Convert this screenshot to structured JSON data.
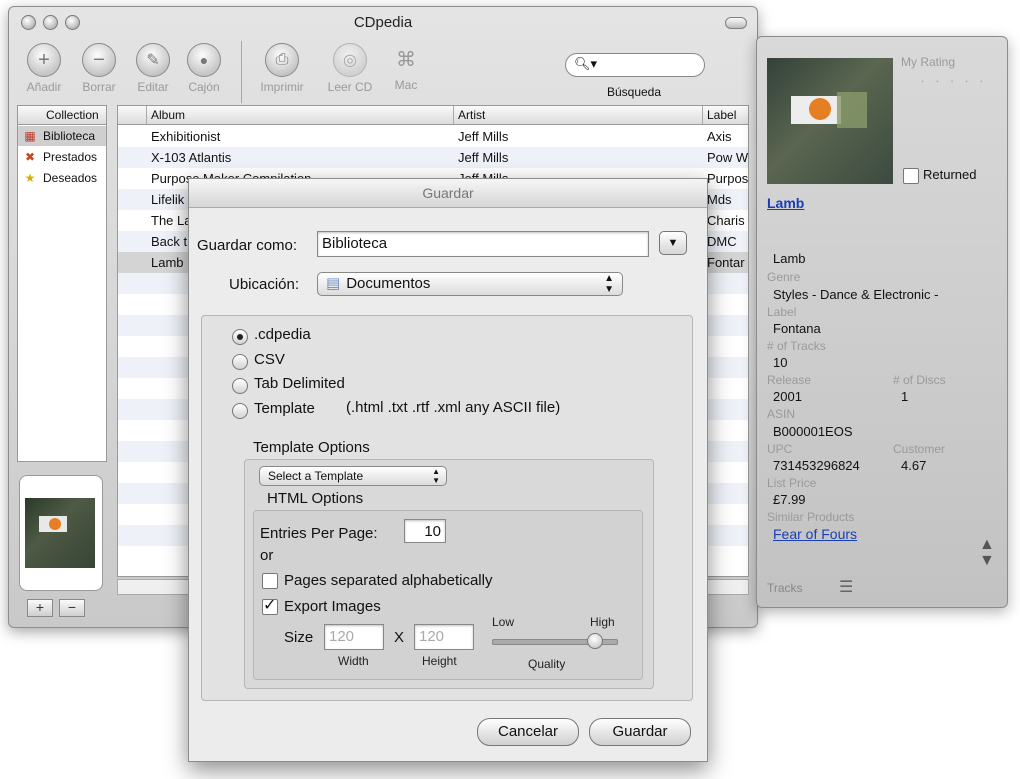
{
  "app": {
    "title": "CDpedia"
  },
  "toolbar": {
    "add": "Añadir",
    "delete": "Borrar",
    "edit": "Editar",
    "drawer": "Cajón",
    "print": "Imprimir",
    "read_cd": "Leer CD",
    "mac": "Mac",
    "search_label": "Búsqueda"
  },
  "sidebar": {
    "header": "Collection",
    "items": [
      {
        "label": "Biblioteca"
      },
      {
        "label": "Prestados"
      },
      {
        "label": "Deseados"
      }
    ]
  },
  "table": {
    "columns": [
      "Album",
      "Artist",
      "Label"
    ],
    "rows": [
      {
        "album": "Exhibitionist",
        "artist": "Jeff Mills",
        "label": "Axis"
      },
      {
        "album": "X-103 Atlantis",
        "artist": "Jeff Mills",
        "label": "Pow W"
      },
      {
        "album": "Purpose Maker Compilation",
        "artist": "Jeff Mills",
        "label": "Purpos"
      },
      {
        "album": "Lifelik",
        "artist": "",
        "label": "Mds"
      },
      {
        "album": "The La",
        "artist": "",
        "label": "Charis"
      },
      {
        "album": "Back t",
        "artist": "",
        "label": "DMC"
      },
      {
        "album": "Lamb",
        "artist": "",
        "label": "Fontar"
      }
    ]
  },
  "details": {
    "my_rating_label": "My Rating",
    "rating_dots": ". . . . .",
    "returned_label": "Returned",
    "title_link": "Lamb",
    "artist": "Lamb",
    "genre_label": "Genre",
    "genre": "Styles - Dance & Electronic -",
    "label_label": "Label",
    "label": "Fontana",
    "tracks_count_label": "# of Tracks",
    "tracks_count": "10",
    "release_label": "Release",
    "release": "2001",
    "discs_label": "# of Discs",
    "discs": "1",
    "asin_label": "ASIN",
    "asin": "B000001EOS",
    "upc_label": "UPC",
    "upc": "731453296824",
    "customer_label": "Customer",
    "customer": "4.67",
    "list_price_label": "List Price",
    "list_price": "£7.99",
    "similar_label": "Similar Products",
    "similar_link": "Fear of Fours",
    "tracks_label": "Tracks"
  },
  "dialog": {
    "title": "Guardar",
    "save_as_label": "Guardar como:",
    "save_as_value": "Biblioteca",
    "location_label": "Ubicación:",
    "location_value": "Documentos",
    "formats": [
      {
        "label": ".cdpedia",
        "selected": true
      },
      {
        "label": "CSV",
        "selected": false
      },
      {
        "label": "Tab Delimited",
        "selected": false
      },
      {
        "label": "Template",
        "selected": false
      }
    ],
    "template_extensions": "(.html .txt .rtf .xml any ASCII file)",
    "template_options_label": "Template Options",
    "select_template": "Select a Template",
    "html_options_label": "HTML Options",
    "entries_per_page_label": "Entries Per Page:",
    "entries_per_page": "10",
    "or_label": "or",
    "pages_alpha_label": "Pages separated alphabetically",
    "pages_alpha_checked": false,
    "export_images_label": "Export Images",
    "export_images_checked": true,
    "size_label": "Size",
    "width_value": "120",
    "x_label": "X",
    "height_value": "120",
    "width_label": "Width",
    "height_label": "Height",
    "low_label": "Low",
    "high_label": "High",
    "quality_label": "Quality",
    "quality_level": 0.82,
    "cancel_button": "Cancelar",
    "save_button": "Guardar"
  }
}
